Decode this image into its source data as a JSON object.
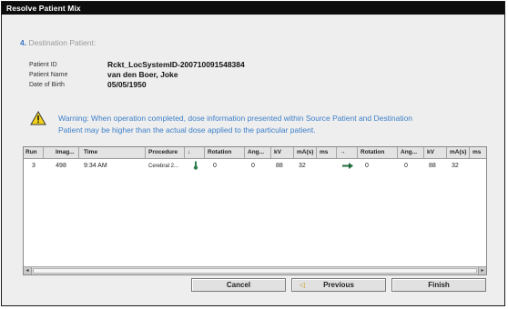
{
  "window": {
    "title": "Resolve Patient Mix"
  },
  "step": {
    "number": "4.",
    "title": "Destination Patient:"
  },
  "patient": {
    "id_label": "Patient ID",
    "id_value": "Rckt_LocSystemID-200710091548384",
    "name_label": "Patient Name",
    "name_value": "van den Boer, Joke",
    "dob_label": "Date of Birth",
    "dob_value": "05/05/1950"
  },
  "warning": {
    "icon": "warning-triangle-icon",
    "text": "Warning: When operation completed, dose information presented within Source Patient and Destination Patient may be higher than the actual dose applied to the particular patient."
  },
  "table": {
    "headers": [
      "Run",
      "Imag...",
      "Time",
      "Procedure",
      "↓",
      "Rotation",
      "Ang...",
      "kV",
      "mA(s)",
      "ms",
      "→",
      "Rotation",
      "Ang...",
      "kV",
      "mA(s)",
      "ms"
    ],
    "rows": [
      {
        "run": "3",
        "images": "498",
        "time": "9:34 AM",
        "procedure": "Cerebral 2...",
        "frontal_icon": "thermometer-icon",
        "rotation1": "0",
        "angulation1": "0",
        "kv1": "88",
        "mas1": "32",
        "ms1": "",
        "lateral_icon": "right-arrow-icon",
        "rotation2": "0",
        "angulation2": "0",
        "kv2": "88",
        "mas2": "32",
        "ms2": ""
      }
    ]
  },
  "buttons": {
    "cancel": "Cancel",
    "previous": "Previous",
    "finish": "Finish"
  },
  "colors": {
    "title_bar": "#0d0d0d",
    "accent_blue": "#3d7fc9",
    "warning_yellow": "#f2d21b"
  }
}
